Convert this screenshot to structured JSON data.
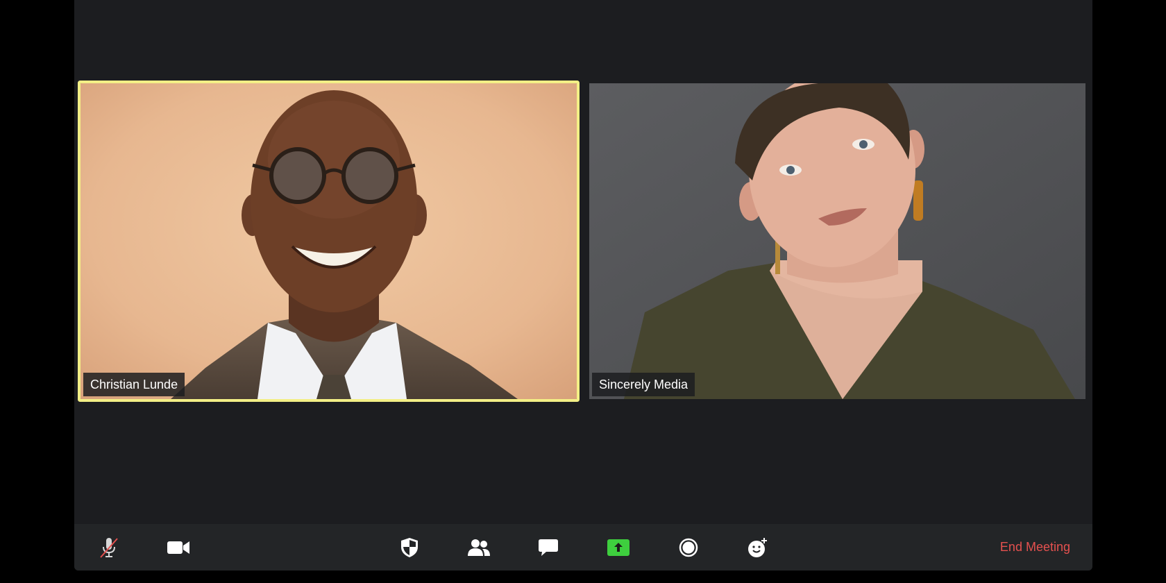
{
  "participants": [
    {
      "name": "Christian Lunde",
      "active_speaker": true
    },
    {
      "name": "Sincerely Media",
      "active_speaker": false
    }
  ],
  "toolbar": {
    "end_meeting_label": "End Meeting",
    "icons": [
      "microphone-muted-icon",
      "video-camera-icon",
      "shield-icon",
      "participants-icon",
      "chat-icon",
      "share-screen-icon",
      "record-icon",
      "reactions-icon"
    ]
  },
  "colors": {
    "background": "#1c1d20",
    "toolbar": "#232527",
    "active_speaker_border": "#f3ef86",
    "end_meeting": "#e5514f",
    "share_screen": "#3ecf3e",
    "mute_slash": "#e5514f"
  }
}
